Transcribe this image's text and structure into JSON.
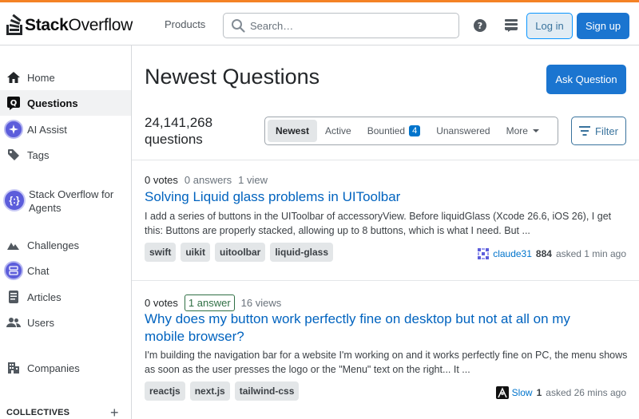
{
  "header": {
    "logo_bold": "Stack",
    "logo_light": "Overflow",
    "products": "Products",
    "search_placeholder": "Search…",
    "login": "Log in",
    "signup": "Sign up"
  },
  "sidebar": {
    "items": [
      {
        "label": "Home",
        "icon": "home-icon"
      },
      {
        "label": "Questions",
        "icon": "questions-icon",
        "active": true
      },
      {
        "label": "AI Assist",
        "icon": "ai-assist-icon"
      },
      {
        "label": "Tags",
        "icon": "tag-icon"
      },
      {
        "label": "Stack Overflow for Agents",
        "icon": "agents-icon"
      },
      {
        "label": "Challenges",
        "icon": "challenges-icon"
      },
      {
        "label": "Chat",
        "icon": "chat-icon"
      },
      {
        "label": "Articles",
        "icon": "articles-icon"
      },
      {
        "label": "Users",
        "icon": "users-icon"
      },
      {
        "label": "Companies",
        "icon": "companies-icon"
      }
    ],
    "collectives": "COLLECTIVES"
  },
  "main": {
    "title": "Newest Questions",
    "ask_button": "Ask Question",
    "count_number": "24,141,268",
    "count_label": "questions",
    "tabs": [
      {
        "label": "Newest",
        "active": true
      },
      {
        "label": "Active"
      },
      {
        "label": "Bountied",
        "badge": "4"
      },
      {
        "label": "Unanswered"
      },
      {
        "label": "More"
      }
    ],
    "filter": "Filter"
  },
  "questions": [
    {
      "votes": "0 votes",
      "answers": "0 answers",
      "views": "1 view",
      "title": "Solving Liquid glass problems in UIToolbar",
      "excerpt": "I add a series of buttons in the UIToolbar of accessoryView. Before liquidGlass (Xcode 26.6, iOS 26), I get this: Buttons are properly stacked, allowing up to 8 buttons, which is what I need. But ...",
      "tags": [
        "swift",
        "uikit",
        "uitoolbar",
        "liquid-glass"
      ],
      "user": "claude31",
      "rep": "884",
      "time": "asked 1 min ago"
    },
    {
      "votes": "0 votes",
      "answers": "1 answer",
      "views": "16 views",
      "title": "Why does my button work perfectly fine on desktop but not at all on my mobile browser?",
      "excerpt": "I'm building the navigation bar for a website I'm working on and it works perfectly fine on PC, the menu shows as soon as the user presses the logo or the \"Menu\" text on the right... It ...",
      "tags": [
        "reactjs",
        "next.js",
        "tailwind-css"
      ],
      "user": "Slow",
      "rep": "1",
      "time": "asked 26 mins ago"
    }
  ],
  "colors": {
    "accent": "#f48225",
    "primary": "#1b75d0",
    "link": "#0063bf",
    "answered": "#2f6f44"
  }
}
